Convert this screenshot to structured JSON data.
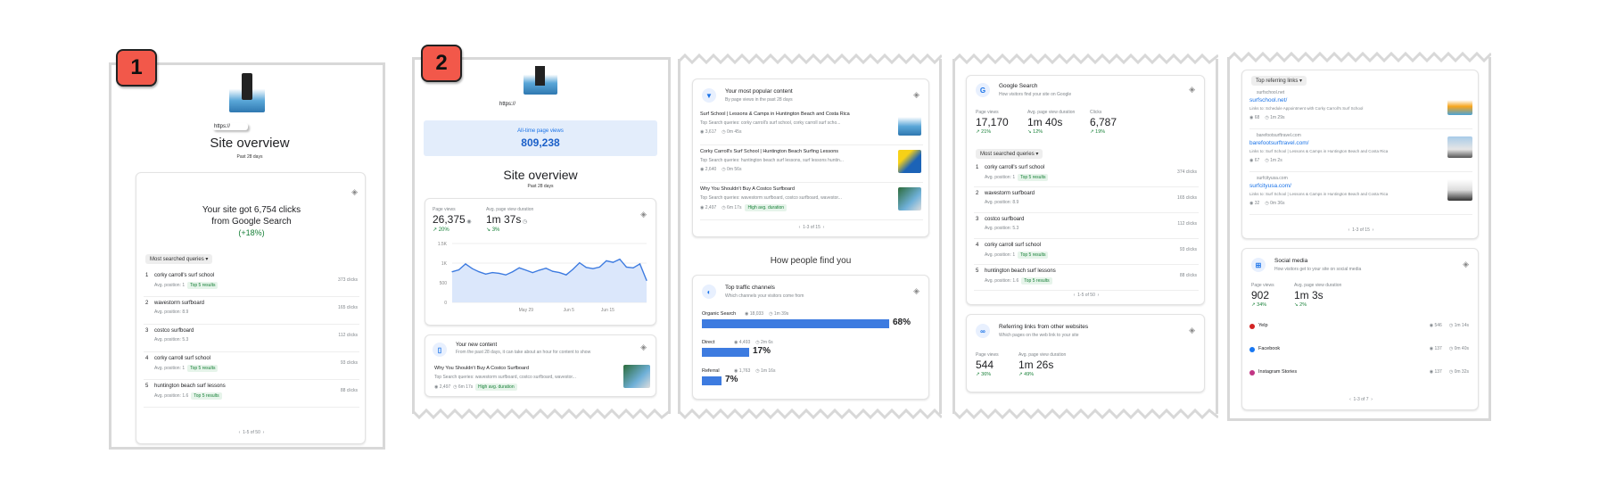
{
  "badges": [
    "1",
    "2"
  ],
  "p1": {
    "url": "https://",
    "title": "Site overview",
    "period": "Past 28 days",
    "clicks_l1": "Your site got 6,754 clicks",
    "clicks_l2": "from Google Search",
    "clicks_change": "(+18%)",
    "dropdown": "Most searched queries ▾",
    "queries": [
      {
        "n": "1",
        "q": "corky carroll's surf school",
        "pos": "Avg. position: 1",
        "chip": "Top 5 results",
        "clicks": "373 clicks"
      },
      {
        "n": "2",
        "q": "wavestorm surfboard",
        "pos": "Avg. position: 8.9",
        "chip": "",
        "clicks": "165 clicks"
      },
      {
        "n": "3",
        "q": "costco surfboard",
        "pos": "Avg. position: 5.3",
        "chip": "",
        "clicks": "112 clicks"
      },
      {
        "n": "4",
        "q": "corky carroll surf school",
        "pos": "Avg. position: 1",
        "chip": "Top 5 results",
        "clicks": "93 clicks"
      },
      {
        "n": "5",
        "q": "huntington beach surf lessons",
        "pos": "Avg. position: 1.6",
        "chip": "Top 5 results",
        "clicks": "88 clicks"
      }
    ],
    "pager": "1-5 of 50"
  },
  "p2": {
    "url": "https://",
    "alltime_label": "All-time page views",
    "alltime_value": "809,238",
    "title": "Site overview",
    "period": "Past 28 days",
    "pv_label": "Page views",
    "pv_value": "26,375",
    "pv_change": "↗ 20%",
    "dur_label": "Avg. page view duration",
    "dur_value": "1m 37s",
    "dur_change": "↘ 3%",
    "yticks": [
      "1.5K",
      "1K",
      "500",
      "0"
    ],
    "xticks": [
      "May 29",
      "Jun 5",
      "Jun 15"
    ],
    "new_title": "Your new content",
    "new_sub": "From the past 28 days, it can take about an hour for content to show",
    "new_item": "Why You Shouldn't Buy A Costco Surfboard",
    "new_queries": "Top Search queries: wavestorm surfboard, costco surfboard, wavestor...",
    "new_stats": [
      "2,497",
      "6m 17s"
    ],
    "new_chip": "High avg. duration"
  },
  "chart_data": {
    "type": "line",
    "title": "",
    "xlabel": "",
    "ylabel": "",
    "x_ticks": [
      "May 29",
      "Jun 5",
      "Jun 15"
    ],
    "y_ticks": [
      "1.5K",
      "1K",
      "500",
      "0"
    ],
    "ylim": [
      0,
      1500
    ],
    "series": [
      {
        "values": [
          780,
          830,
          980,
          860,
          780,
          720,
          760,
          740,
          700,
          780,
          880,
          820,
          760,
          820,
          870,
          790,
          760,
          700,
          840,
          1010,
          890,
          860,
          900,
          1060,
          1020,
          1100,
          900,
          880,
          980,
          560
        ]
      }
    ]
  },
  "p3": {
    "pop_title": "Your most popular content",
    "pop_sub": "By page views in the past 28 days",
    "pop_items": [
      {
        "t": "Surf School | Lessons & Camps in Huntington Beach and Costa Rica",
        "q": "Top Search queries: corky carroll's surf school, corky carroll surf scho...",
        "s": [
          "3,617",
          "0m 45s"
        ],
        "chip": ""
      },
      {
        "t": "Corky Carroll's Surf School | Huntington Beach Surfing Lessons",
        "q": "Top Search queries: huntington beach surf lessons, surf lessons huntin...",
        "s": [
          "2,640",
          "0m 56s"
        ],
        "chip": ""
      },
      {
        "t": "Why You Shouldn't Buy A Costco Surfboard",
        "q": "Top Search queries: wavestorm surfboard, costco surfboard, wavestor...",
        "s": [
          "2,497",
          "6m 17s"
        ],
        "chip": "High avg. duration"
      }
    ],
    "pop_pager": "1-3 of 15",
    "how": "How people find you",
    "tr_title": "Top traffic channels",
    "tr_sub": "Which channels your visitors come from",
    "channels": [
      {
        "name": "Organic Search",
        "v": "18,033",
        "d": "1m 39s",
        "pct": "68%",
        "frac": 0.68
      },
      {
        "name": "Direct",
        "v": "4,493",
        "d": "2m 6s",
        "pct": "17%",
        "frac": 0.17
      },
      {
        "name": "Referral",
        "v": "1,763",
        "d": "1m 16s",
        "pct": "7%",
        "frac": 0.07
      }
    ]
  },
  "p4": {
    "gs_title": "Google Search",
    "gs_sub": "How visitors find your site on Google",
    "m": [
      {
        "l": "Page views",
        "v": "17,170",
        "c": "↗ 21%"
      },
      {
        "l": "Avg. page view duration",
        "v": "1m 40s",
        "c": "↘ 12%"
      },
      {
        "l": "Clicks",
        "v": "6,787",
        "c": "↗ 19%"
      }
    ],
    "dropdown": "Most searched queries ▾",
    "queries": [
      {
        "n": "1",
        "q": "corky carroll's surf school",
        "pos": "Avg. position: 1",
        "chip": "Top 5 results",
        "clicks": "374 clicks"
      },
      {
        "n": "2",
        "q": "wavestorm surfboard",
        "pos": "Avg. position: 8.9",
        "chip": "",
        "clicks": "165 clicks"
      },
      {
        "n": "3",
        "q": "costco surfboard",
        "pos": "Avg. position: 5.3",
        "chip": "",
        "clicks": "112 clicks"
      },
      {
        "n": "4",
        "q": "corky carroll surf school",
        "pos": "Avg. position: 1",
        "chip": "Top 5 results",
        "clicks": "93 clicks"
      },
      {
        "n": "5",
        "q": "huntington beach surf lessons",
        "pos": "Avg. position: 1.6",
        "chip": "Top 5 results",
        "clicks": "88 clicks"
      }
    ],
    "pager": "1-5 of 50",
    "ref_title": "Referring links from other websites",
    "ref_sub": "Which pages on the web link to your site",
    "ref_m": [
      {
        "l": "Page views",
        "v": "544",
        "c": "↗ 36%"
      },
      {
        "l": "Avg. page view duration",
        "v": "1m 26s",
        "c": "↗ 49%"
      }
    ]
  },
  "p5": {
    "dropdown": "Top referring links ▾",
    "links": [
      {
        "site": "surfschool.net",
        "url": "surfschool.net/",
        "to": "Links to: Schedule Appointment with Corky Carroll's Surf School",
        "s": [
          "68",
          "1m 29s"
        ]
      },
      {
        "site": "barefootsurftravel.com",
        "url": "barefootsurftravel.com/",
        "to": "Links to: Surf School | Lessons & Camps in Huntington Beach and Costa Rica",
        "s": [
          "67",
          "1m 2s"
        ]
      },
      {
        "site": "surfcityusa.com",
        "url": "surfcityusa.com/",
        "to": "Links to: Surf School | Lessons & Camps in Huntington Beach and Costa Rica",
        "s": [
          "32",
          "0m 36s"
        ]
      }
    ],
    "pager": "1-3 of 15",
    "sm_title": "Social media",
    "sm_sub": "How visitors get to your site on social media",
    "sm_m": [
      {
        "l": "Page views",
        "v": "902",
        "c": "↗ 34%"
      },
      {
        "l": "Avg. page view duration",
        "v": "1m 3s",
        "c": "↘ 2%"
      }
    ],
    "social": [
      {
        "n": "Yelp",
        "v": "546",
        "d": "1m 14s",
        "color": "#d32323"
      },
      {
        "n": "Facebook",
        "v": "137",
        "d": "0m 40s",
        "color": "#1877f2"
      },
      {
        "n": "Instagram Stories",
        "v": "137",
        "d": "0m 32s",
        "color": "#c13584"
      }
    ],
    "sm_pager": "1-3 of 7"
  }
}
